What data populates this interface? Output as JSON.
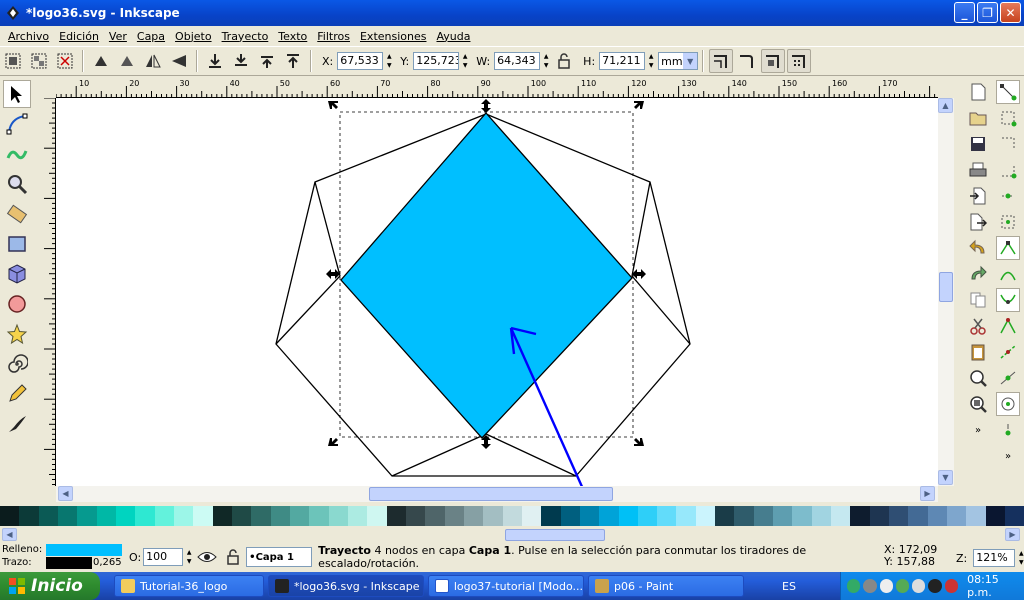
{
  "window": {
    "title": "*logo36.svg - Inkscape",
    "btn_min": "_",
    "btn_max": "❐",
    "btn_close": "✕"
  },
  "menu": [
    "Archivo",
    "Edición",
    "Ver",
    "Capa",
    "Objeto",
    "Trayecto",
    "Texto",
    "Filtros",
    "Extensiones",
    "Ayuda"
  ],
  "toolbar": {
    "x_label": "X:",
    "x_value": "67,533",
    "y_label": "Y:",
    "y_value": "125,723",
    "w_label": "W:",
    "w_value": "64,343",
    "h_label": "H:",
    "h_value": "71,211",
    "unit": "mm"
  },
  "ruler": {
    "h_ticks": [
      "10",
      "20",
      "30",
      "40",
      "50",
      "60",
      "70",
      "80",
      "90",
      "100",
      "110",
      "120",
      "130",
      "140",
      "150",
      "160",
      "170"
    ]
  },
  "palette": [
    "#0b1c1d",
    "#0c3a38",
    "#0b5a55",
    "#08776f",
    "#069a8f",
    "#00b8a6",
    "#00d4c0",
    "#2ee8d2",
    "#63f2dc",
    "#9cf6e8",
    "#ccfbf4",
    "#102826",
    "#1f4a46",
    "#2f6b66",
    "#3f8b85",
    "#53a9a1",
    "#6cc4ba",
    "#8ad9cf",
    "#acebe2",
    "#cff7f1",
    "#1d2b2e",
    "#36484c",
    "#4f6569",
    "#6a8286",
    "#86a0a4",
    "#a3bec2",
    "#c2dadd",
    "#e0f0f2",
    "#003a4e",
    "#005f7f",
    "#0082ad",
    "#00a3d8",
    "#00c0f6",
    "#2ecff8",
    "#62dcfa",
    "#97e8fb",
    "#cbf4fd",
    "#1a3c48",
    "#2f5c6b",
    "#467d8e",
    "#5e9eb0",
    "#7dbccc",
    "#a1d4e1",
    "#c5e8f0",
    "#0e1c2e",
    "#1e3551",
    "#2f4e73",
    "#436a95",
    "#5e88b4",
    "#7ea6cd",
    "#a3c4e2",
    "#0a1630",
    "#15305e"
  ],
  "status": {
    "fill_label": "Relleno:",
    "stroke_label": "Trazo:",
    "stroke_width": "0,265",
    "fill_color": "#00bfff",
    "stroke_color": "#000000",
    "opacity_label": "O:",
    "opacity_value": "100",
    "layer": "•Capa 1",
    "msg_bold1": "Trayecto",
    "msg_mid": " 4 nodos en capa ",
    "msg_bold2": "Capa 1",
    "msg_end": ". Pulse en la selección para conmutar los tiradores de escalado/rotación.",
    "x_coord": "X:  172,09",
    "y_coord": "Y:  157,88",
    "zoom_label": "Z:",
    "zoom_value": "121%"
  },
  "taskbar": {
    "start": "Inicio",
    "tasks": [
      "Tutorial-36_logo",
      "*logo36.svg - Inkscape",
      "logo37-tutorial [Modo...",
      "p06 - Paint"
    ],
    "lang": "ES",
    "clock": "08:15 p.m."
  },
  "colors": {
    "shape_fill": "#00bfff",
    "arrow": "#0000ff",
    "title_bg": "#0a58e6"
  }
}
